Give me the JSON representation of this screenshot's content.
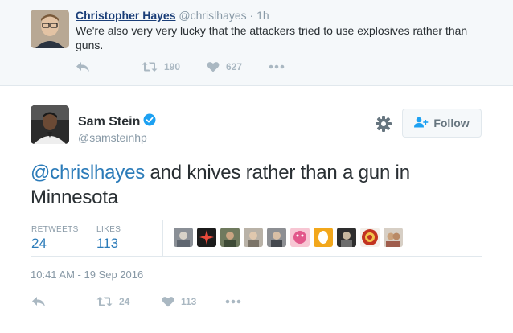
{
  "parent_tweet": {
    "name": "Christopher Hayes",
    "handle": "@chrislhayes",
    "separator": "·",
    "time": "1h",
    "text": "We're also very very lucky that the attackers tried to use explosives rather than guns.",
    "retweets": "190",
    "likes": "627"
  },
  "tweet": {
    "name": "Sam Stein",
    "handle": "@samsteinhp",
    "follow_label": "Follow",
    "mention": "@chrislhayes",
    "text_rest": " and knives rather than a gun in Minnesota",
    "retweets_label": "RETWEETS",
    "retweets_value": "24",
    "likes_label": "LIKES",
    "likes_value": "113",
    "timestamp": "10:41 AM - 19 Sep 2016",
    "action_retweets": "24",
    "action_likes": "113"
  },
  "icons": {
    "reply": "reply-icon",
    "retweet": "retweet-icon",
    "like": "heart-icon",
    "more": "more-icon",
    "verified": "verified-badge-icon",
    "gear": "gear-icon",
    "follow": "add-user-icon"
  },
  "colors": {
    "link": "#2b7bb9",
    "name_link": "#1a3e78",
    "muted": "#8899a6",
    "icon_gray": "#aab8c2",
    "verified": "#1da1f2"
  }
}
